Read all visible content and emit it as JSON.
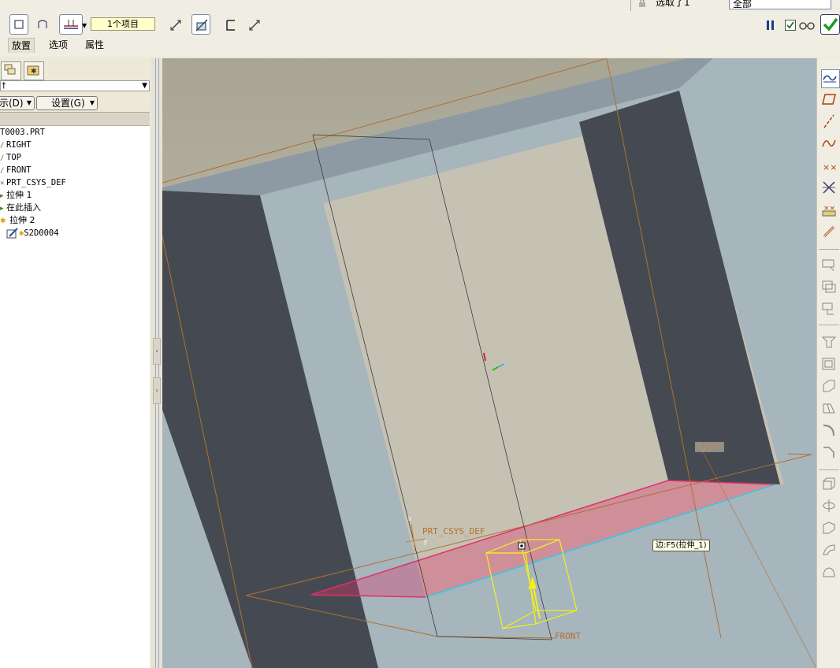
{
  "dashboard": {
    "collector_text": "1个项目",
    "tabs": [
      {
        "label": "放置",
        "active": true
      },
      {
        "label": "选项",
        "active": false
      },
      {
        "label": "属性",
        "active": false
      }
    ],
    "selection_status": "选取了1",
    "filter_value": "全部"
  },
  "model_tree": {
    "show_button": "示(D)",
    "settings_button": "设置(G)",
    "items": [
      {
        "label": "T0003.PRT",
        "icon": ""
      },
      {
        "label": "RIGHT",
        "icon": "datum-plane-icon"
      },
      {
        "label": "TOP",
        "icon": "datum-plane-icon"
      },
      {
        "label": "FRONT",
        "icon": "datum-plane-icon"
      },
      {
        "label": "PRT_CSYS_DEF",
        "icon": "csys-icon"
      },
      {
        "label": "拉伸 1",
        "icon": "extrude-icon"
      },
      {
        "label": "在此插入",
        "icon": "insert-here-icon"
      },
      {
        "label": "拉伸 2",
        "icon": "extrude-icon"
      },
      {
        "label": "S2D0004",
        "icon": "sketch-icon"
      }
    ]
  },
  "viewport": {
    "label_right": "RIGHT",
    "label_front": "FRONT",
    "label_csys": "PRT_CSYS_DEF",
    "csys_x": "x",
    "csys_y": "y",
    "tooltip": "边:F5(拉伸_1)"
  },
  "colors": {
    "background_top": "#a8a595",
    "background_bottom": "#d0ccbe",
    "part_light": "#a7b5bd",
    "part_dark": "#454a52",
    "datum_plane": "#b07030",
    "preview_yellow": "#f0f020",
    "highlight_red": "#e0306a"
  }
}
